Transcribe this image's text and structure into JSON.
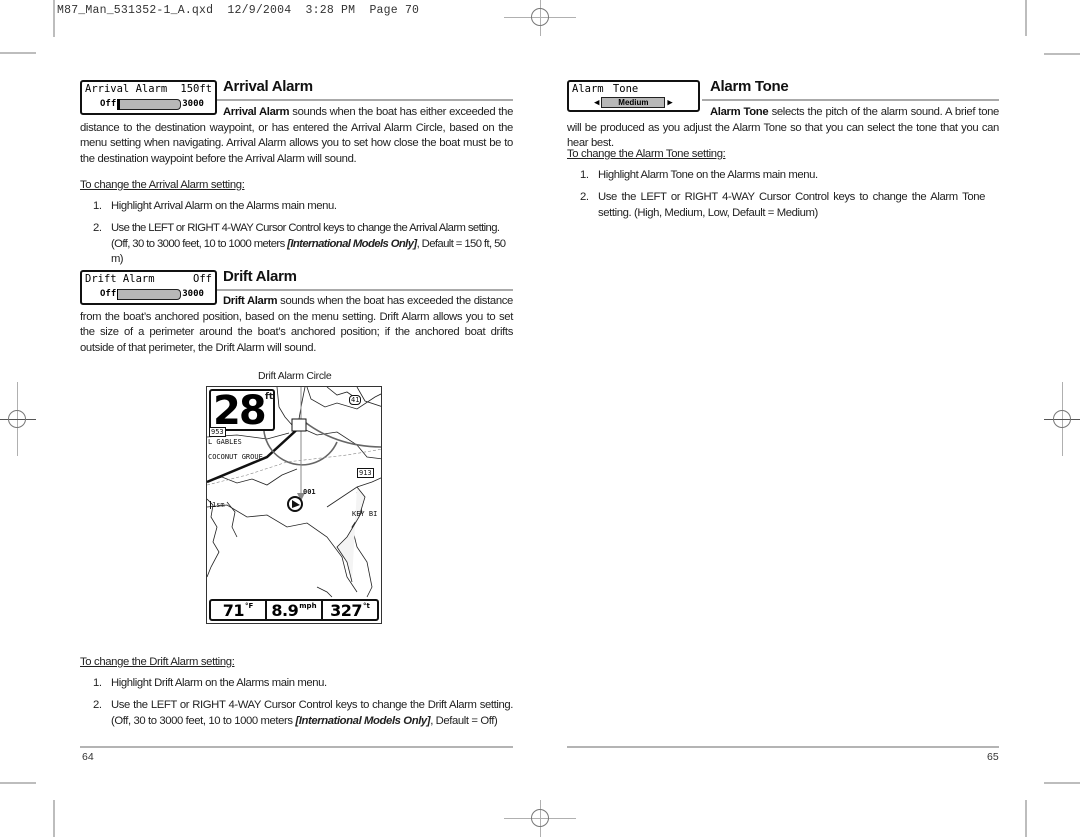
{
  "slug": "M87_Man_531352-1_A.qxd  12/9/2004  3:28 PM  Page 70",
  "left_page": {
    "number": "64",
    "arrival_alarm": {
      "widget": {
        "label": "Arrival Alarm",
        "value": "150ft",
        "min": "Off",
        "max": "3000",
        "slider_fraction": 0.0
      },
      "title": "Arrival Alarm",
      "intro_bold": "Arrival Alarm",
      "intro_rest": " sounds when the boat has either exceeded the distance to the destination waypoint, or has entered the Arrival Alarm Circle, based on the menu setting when navigating.  Arrival Alarm allows you to set how close the boat must be to the destination waypoint before the Arrival Alarm will sound.",
      "subhead": "To change the Arrival Alarm setting:",
      "steps": [
        {
          "num": "1.",
          "text": "Highlight Arrival Alarm on the Alarms main menu."
        },
        {
          "num": "2.",
          "text_a": "Use the LEFT or RIGHT 4-WAY Cursor Control keys to change the Arrival Alarm setting. (Off, 30 to 3000 feet, 10 to 1000 meters ",
          "text_em": "[International Models Only]",
          "text_b": ", Default = 150 ft, 50 m)"
        }
      ]
    },
    "drift_alarm": {
      "widget": {
        "label": "Drift Alarm",
        "value": "Off",
        "min": "Off",
        "max": "3000",
        "slider_fraction": 0.0
      },
      "title": "Drift Alarm",
      "intro_bold": "Drift Alarm",
      "intro_rest": " sounds when the boat has exceeded the distance from the boat’s anchored position, based on the menu setting. Drift Alarm allows you to set the size of a perimeter around the boat’s anchored position; if the anchored boat drifts outside of that perimeter, the Drift Alarm will sound.",
      "figure": {
        "caption": "Drift Alarm Circle",
        "depth": "28",
        "depth_unit": "ft",
        "map_labels": [
          "41",
          "953",
          "L GABLES",
          "COCONUT GROUE",
          "913",
          "001",
          "KEY BI",
          "1sm"
        ],
        "readouts": [
          {
            "value": "71",
            "unit": "°F"
          },
          {
            "value": "8.9",
            "unit": "mph"
          },
          {
            "value": "327",
            "unit": "°t"
          }
        ]
      },
      "subhead": "To change the Drift Alarm setting:",
      "steps": [
        {
          "num": "1.",
          "text": "Highlight Drift Alarm on the Alarms main menu."
        },
        {
          "num": "2.",
          "text_a": "Use the LEFT or RIGHT 4-WAY Cursor Control keys to change the Drift Alarm setting. (Off, 30 to 3000 feet, 10 to 1000 meters ",
          "text_em": "[International Models Only]",
          "text_b": ", Default = Off)"
        }
      ]
    }
  },
  "right_page": {
    "number": "65",
    "alarm_tone": {
      "widget": {
        "label": "Alarm Tone",
        "value": "Medium"
      },
      "title": "Alarm Tone",
      "intro_bold": "Alarm Tone",
      "intro_rest": " selects the pitch of the alarm sound. A brief tone will be produced as you adjust the Alarm Tone so that you can select the tone that you can hear best.",
      "subhead": "To change the Alarm Tone setting:",
      "steps": [
        {
          "num": "1.",
          "text": "Highlight Alarm Tone on the Alarms main menu."
        },
        {
          "num": "2.",
          "text": "Use the LEFT or RIGHT 4-WAY Cursor Control keys to change the Alarm Tone setting. (High, Medium, Low, Default = Medium)"
        }
      ]
    }
  }
}
